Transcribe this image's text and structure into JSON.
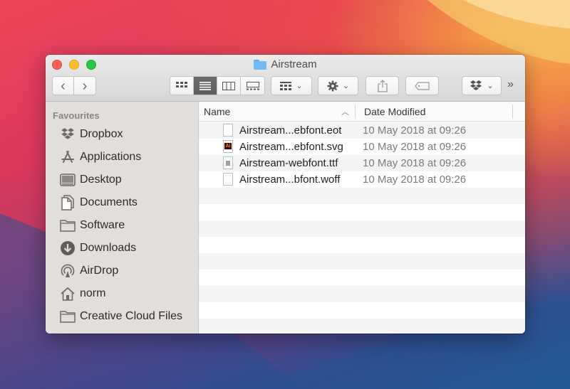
{
  "window": {
    "title": "Airstream",
    "folder_icon": "folder-icon"
  },
  "toolbar": {
    "back_icon": "chevron-left-icon",
    "forward_icon": "chevron-right-icon",
    "views": [
      {
        "name": "icon-view",
        "active": false
      },
      {
        "name": "list-view",
        "active": true
      },
      {
        "name": "column-view",
        "active": false
      },
      {
        "name": "gallery-view",
        "active": false
      }
    ],
    "group_icon": "group-icon",
    "action_icon": "gear-icon",
    "share_icon": "share-icon",
    "tag_icon": "tag-icon",
    "dropbox_icon": "dropbox-icon",
    "more_label": "»"
  },
  "sidebar": {
    "header": "Favourites",
    "items": [
      {
        "label": "Dropbox",
        "icon": "dropbox-icon"
      },
      {
        "label": "Applications",
        "icon": "applications-icon"
      },
      {
        "label": "Desktop",
        "icon": "desktop-icon"
      },
      {
        "label": "Documents",
        "icon": "documents-icon"
      },
      {
        "label": "Software",
        "icon": "folder-icon"
      },
      {
        "label": "Downloads",
        "icon": "downloads-icon"
      },
      {
        "label": "AirDrop",
        "icon": "airdrop-icon"
      },
      {
        "label": "norm",
        "icon": "home-icon"
      },
      {
        "label": "Creative Cloud Files",
        "icon": "folder-icon"
      }
    ]
  },
  "columns": {
    "name": "Name",
    "date": "Date Modified"
  },
  "files": [
    {
      "name": "Airstream...ebfont.eot",
      "date": "10 May 2018 at 09:26",
      "icon": "document-icon"
    },
    {
      "name": "Airstream...ebfont.svg",
      "date": "10 May 2018 at 09:26",
      "icon": "illustrator-file-icon"
    },
    {
      "name": "Airstream-webfont.ttf",
      "date": "10 May 2018 at 09:26",
      "icon": "font-file-icon"
    },
    {
      "name": "Airstream...bfont.woff",
      "date": "10 May 2018 at 09:26",
      "icon": "document-icon"
    }
  ]
}
